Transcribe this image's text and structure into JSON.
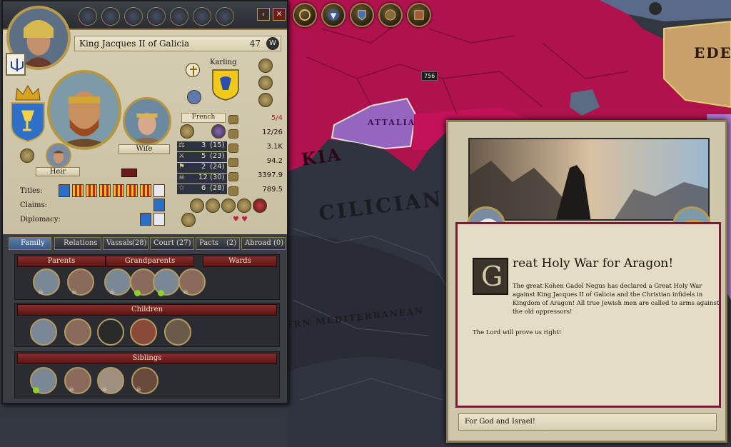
{
  "character": {
    "name": "King Jacques II of Galicia",
    "age": "47",
    "w_button": "W",
    "dynasty": "Karling",
    "culture": "French",
    "wife_label": "Wife",
    "heir_label": "Heir",
    "stats": [
      {
        "value": "3",
        "base": "(15)"
      },
      {
        "value": "5",
        "base": "(23)"
      },
      {
        "value": "2",
        "base": "(24)"
      },
      {
        "value": "12",
        "base": "(30)"
      },
      {
        "value": "6",
        "base": "(28)"
      }
    ],
    "resources": [
      {
        "value": "5/4",
        "alert": true
      },
      {
        "value": "12/26"
      },
      {
        "value": "3.1K"
      },
      {
        "value": "94.2"
      },
      {
        "value": "3397.9"
      },
      {
        "value": "789.5"
      }
    ],
    "titles_label": "Titles:",
    "claims_label": "Claims:",
    "diplomacy_label": "Diplomacy:"
  },
  "tabs": [
    {
      "label": "Family",
      "count": ""
    },
    {
      "label": "Relations",
      "count": ""
    },
    {
      "label": "Vassals",
      "count": "(28)"
    },
    {
      "label": "Court",
      "count": "(27)"
    },
    {
      "label": "Pacts",
      "count": "(2)"
    },
    {
      "label": "Abroad",
      "count": "(0)"
    }
  ],
  "family": {
    "parents_label": "Parents",
    "grandparents_label": "Grandparents",
    "wards_label": "Wards",
    "children_label": "Children",
    "siblings_label": "Siblings"
  },
  "map": {
    "region_label": "CILICIAN",
    "sea_label": "ERN MEDITERRANEAN",
    "province_label": "ATTALIA",
    "kingdom_fragment": "KIA",
    "edessa_label": "EDES",
    "army_count": "756"
  },
  "event": {
    "title": "reat Holy War for Aragon!",
    "dropcap": "G",
    "body": "The great Kohen Gadol Negus has declared a Great Holy War against King Jacques II of Galicia and the Christian infidels in Kingdom of Aragon! All true Jewish men are called to arms against the old oppressors!",
    "body2": "The Lord will prove us right!",
    "option": "For God and Israel!"
  },
  "colors": {
    "map_crimson": "#b0124e",
    "map_purple": "#8a5bb0",
    "sea": "#2f3440",
    "event_border": "#7a1a36"
  }
}
